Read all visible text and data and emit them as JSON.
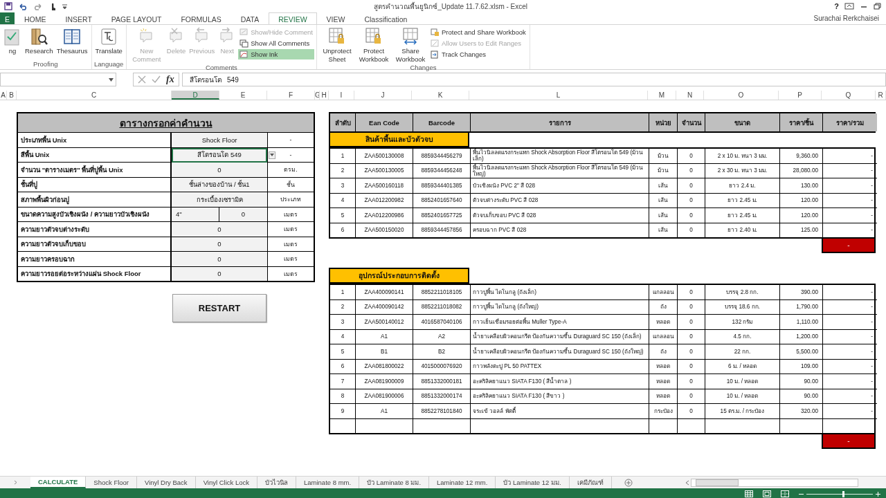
{
  "window": {
    "title": "สูตรคำนวณพื้นยูนิกซ์_Update 11.7.62.xlsm - Excel",
    "help": "?"
  },
  "ribbon_tabs": [
    {
      "label": "E",
      "kind": "file",
      "selected": false
    },
    {
      "label": "HOME",
      "kind": "tab",
      "selected": false
    },
    {
      "label": "INSERT",
      "kind": "tab",
      "selected": false
    },
    {
      "label": "PAGE LAYOUT",
      "kind": "tab",
      "selected": false
    },
    {
      "label": "FORMULAS",
      "kind": "tab",
      "selected": false
    },
    {
      "label": "DATA",
      "kind": "tab",
      "selected": false
    },
    {
      "label": "REVIEW",
      "kind": "tab",
      "selected": true
    },
    {
      "label": "VIEW",
      "kind": "tab",
      "selected": false
    },
    {
      "label": "Classification",
      "kind": "tab",
      "selected": false
    }
  ],
  "user": "Surachai Rerkchaisei",
  "ribbon_groups": [
    {
      "label": "Proofing",
      "commands": [
        {
          "label": "ng",
          "kind": "large",
          "disabled": false,
          "on": false
        },
        {
          "label": "Research",
          "kind": "large",
          "disabled": false,
          "on": false
        },
        {
          "label": "Thesaurus",
          "kind": "large",
          "disabled": false,
          "on": false
        }
      ]
    },
    {
      "label": "Language",
      "commands": [
        {
          "label": "Translate",
          "kind": "large",
          "disabled": false,
          "on": false
        }
      ]
    },
    {
      "label": "Comments",
      "commands": [
        {
          "label": "New Comment",
          "kind": "large",
          "disabled": true,
          "on": false
        },
        {
          "label": "Delete",
          "kind": "large",
          "disabled": true,
          "on": false
        },
        {
          "label": "Previous",
          "kind": "large",
          "disabled": true,
          "on": false
        },
        {
          "label": "Next",
          "kind": "large",
          "disabled": true,
          "on": false
        },
        {
          "label": "Show/Hide Comment",
          "kind": "small",
          "disabled": true,
          "on": false
        },
        {
          "label": "Show All Comments",
          "kind": "small",
          "disabled": false,
          "on": false
        },
        {
          "label": "Show Ink",
          "kind": "small",
          "disabled": false,
          "on": true
        }
      ]
    },
    {
      "label": "Changes",
      "commands": [
        {
          "label": "Unprotect Sheet",
          "kind": "large",
          "disabled": false,
          "on": false
        },
        {
          "label": "Protect Workbook",
          "kind": "large",
          "disabled": false,
          "on": false
        },
        {
          "label": "Share Workbook",
          "kind": "large",
          "disabled": false,
          "on": false
        },
        {
          "label": "Protect and Share Workbook",
          "kind": "small",
          "disabled": false,
          "on": false
        },
        {
          "label": "Allow Users to Edit Ranges",
          "kind": "small",
          "disabled": true,
          "on": false
        },
        {
          "label": "Track Changes",
          "kind": "small",
          "disabled": false,
          "on": false
        }
      ]
    }
  ],
  "formula_bar": {
    "fx": "fx",
    "value": "สีโตรอนโต   549"
  },
  "columns": [
    {
      "label": "A",
      "selected": false
    },
    {
      "label": "B",
      "selected": false
    },
    {
      "label": "C",
      "selected": false
    },
    {
      "label": "D",
      "selected": true
    },
    {
      "label": "E",
      "selected": false
    },
    {
      "label": "F",
      "selected": false
    },
    {
      "label": "G",
      "selected": false
    },
    {
      "label": "H",
      "selected": false
    },
    {
      "label": "I",
      "selected": false
    },
    {
      "label": "J",
      "selected": false
    },
    {
      "label": "K",
      "selected": false
    },
    {
      "label": "L",
      "selected": false
    },
    {
      "label": "M",
      "selected": false
    },
    {
      "label": "N",
      "selected": false
    },
    {
      "label": "O",
      "selected": false
    },
    {
      "label": "P",
      "selected": false
    },
    {
      "label": "Q",
      "selected": false
    },
    {
      "label": "R",
      "selected": false
    }
  ],
  "calc_form": {
    "title": "ตารางกรอกค่าคำนวน",
    "rows": [
      {
        "label": "ประเภทพื้น Unix",
        "values": [
          "Shock Floor"
        ],
        "unit": "-",
        "selected": false
      },
      {
        "label": "สีพื้น Unix",
        "values": [
          "สีโตรอนโต 549"
        ],
        "unit": "-",
        "selected": true
      },
      {
        "label": "จำนวน \"ตารางเมตร\" พื้นที่ปูพื้น Unix",
        "values": [
          "0"
        ],
        "unit": "ตรม.",
        "selected": false
      },
      {
        "label": "ชั้นที่ปู",
        "values": [
          "ชั้นล่างของบ้าน / ชั้น1"
        ],
        "unit": "ชั้น",
        "selected": false
      },
      {
        "label": "สภาพพื้นผิวก่อนปู",
        "values": [
          "กระเบื้องเซรามิค"
        ],
        "unit": "ประเภท",
        "selected": false
      },
      {
        "label": "ขนาดความสูงบัวเชิงผนัง / ความยาวบัวเชิงผนัง",
        "values": [
          "4\"",
          "0"
        ],
        "unit": "เมตร",
        "selected": false
      },
      {
        "label": "ความยาวตัวจบต่างระดับ",
        "values": [
          "0"
        ],
        "unit": "เมตร",
        "selected": false
      },
      {
        "label": "ความยาวตัวจบเก็บขอบ",
        "values": [
          "0"
        ],
        "unit": "เมตร",
        "selected": false
      },
      {
        "label": "ความยาวครอบฉาก",
        "values": [
          "0"
        ],
        "unit": "เมตร",
        "selected": false
      },
      {
        "label": "ความยาวรอยต่อระหว่างแผ่น Shock Floor",
        "values": [
          "0"
        ],
        "unit": "เมตร",
        "selected": false
      }
    ],
    "button": "RESTART"
  },
  "product_table": {
    "columns": [
      "ลำดับ",
      "Ean Code",
      "Barcode",
      "รายการ",
      "หน่วย",
      "จำนวน",
      "ขนาด",
      "ราคา/ชิ้น",
      "ราคา/รวม"
    ],
    "sections": [
      {
        "title": "สินค้าพื้นและบัวตัวจบ",
        "total": "-",
        "rows": [
          {
            "kind": "item",
            "cells": [
              "1",
              "ZAA500130008",
              "8859344456279",
              "พื้นไวนิลลดแรงกระแทก Shock Absorption Floor สีโตรอนโต 549 (ม้วนเล็ก)",
              "ม้วน",
              "0",
              "2 x 10 ม. หนา 3 มม.",
              "9,360.00",
              "-"
            ]
          },
          {
            "kind": "item",
            "cells": [
              "2",
              "ZAA500130005",
              "8859344456248",
              "พื้นไวนิลลดแรงกระแทก Shock Absorption Floor สีโตรอนโต 549 (ม้วนใหญ่)",
              "ม้วน",
              "0",
              "2 x 30 ม. หนา 3 มม.",
              "28,080.00",
              "-"
            ]
          },
          {
            "kind": "item",
            "cells": [
              "3",
              "ZAA500160118",
              "8859344401385",
              "บัวเชิงผนัง PVC 2\" สี 028",
              "เส้น",
              "0",
              "ยาว 2.4 ม.",
              "130.00",
              "-"
            ]
          },
          {
            "kind": "item",
            "cells": [
              "4",
              "ZAA012200982",
              "8852401657640",
              "ตัวจบต่างระดับ PVC สี 028",
              "เส้น",
              "0",
              "ยาว 2.45 ม.",
              "120.00",
              "-"
            ]
          },
          {
            "kind": "item",
            "cells": [
              "5",
              "ZAA012200986",
              "8852401657725",
              "ตัวจบเก็บขอบ PVC สี 028",
              "เส้น",
              "0",
              "ยาว 2.45 ม.",
              "120.00",
              "-"
            ]
          },
          {
            "kind": "item",
            "cells": [
              "6",
              "ZAA500150020",
              "8859344457856",
              "ครอบฉาก PVC สี 028",
              "เส้น",
              "0",
              "ยาว 2.40 ม.",
              "125.00",
              "-"
            ]
          }
        ]
      },
      {
        "title": "อุปกรณ์ประกอบการติดตั้ง",
        "total": "-",
        "rows": [
          {
            "kind": "item",
            "cells": [
              "1",
              "ZAA400090141",
              "8852211018105",
              "กาวปูพื้น ไดโนกลู (ถังเล็ก)",
              "แกลลอน",
              "0",
              "บรรจุ 2.8 กก.",
              "390.00",
              "-"
            ]
          },
          {
            "kind": "item",
            "cells": [
              "2",
              "ZAA400090142",
              "8852211018082",
              "กาวปูพื้น ไดโนกลู  (ถังใหญ่)",
              "ถัง",
              "0",
              "บรรจุ 18.6 กก.",
              "1,790.00",
              "-"
            ]
          },
          {
            "kind": "item",
            "cells": [
              "3",
              "ZAA500140012",
              "4016587040106",
              "กาวเย็นเชื่อมรอยต่อพื้น Muller Type-A",
              "หลอด",
              "0",
              "132 กรัม",
              "1,110.00",
              "-"
            ]
          },
          {
            "kind": "item",
            "cells": [
              "4",
              "A1",
              "A2",
              "น้ำยาเคลือบผิวคอนกรีต ป้องกันความชื้น Duraguard SC 150 (ถังเล็ก)",
              "แกลลอน",
              "0",
              "4.5 กก.",
              "1,200.00",
              "-"
            ]
          },
          {
            "kind": "item",
            "cells": [
              "5",
              "B1",
              "B2",
              "น้ำยาเคลือบผิวคอนกรีต ป้องกันความชื้น Duraguard SC 150 (ถังใหญ่)",
              "ถัง",
              "0",
              "22 กก.",
              "5,500.00",
              "-"
            ]
          },
          {
            "kind": "item",
            "cells": [
              "6",
              "ZAA081800022",
              "4015000076920",
              "กาวพลังตะปู PL 50 PATTEX",
              "หลอด",
              "0",
              "6 ม. / หลอด",
              "109.00",
              "-"
            ]
          },
          {
            "kind": "item",
            "cells": [
              "7",
              "ZAA081900009",
              "8851332000181",
              "อะคริลิคยาแนว SIATA F130 ( สีน้ำตาล )",
              "หลอด",
              "0",
              "10 ม. / หลอด",
              "90.00",
              "-"
            ]
          },
          {
            "kind": "item",
            "cells": [
              "8",
              "ZAA081900006",
              "8851332000174",
              "อะคริลิคยาแนว SIATA F130 ( สีขาว )",
              "หลอด",
              "0",
              "10 ม. / หลอด",
              "90.00",
              "-"
            ]
          },
          {
            "kind": "item",
            "cells": [
              "9",
              "A1",
              "8852278101840",
              "จระเข้ วอลล์ พัตตี้",
              "กระป๋อง",
              "0",
              "15 ตร.ม. / กระป๋อง",
              "320.00",
              "-"
            ]
          },
          {
            "kind": "blank"
          }
        ]
      }
    ]
  },
  "sheet_tabs": [
    {
      "label": "CALCULATE",
      "selected": true
    },
    {
      "label": "Shock Floor",
      "selected": false
    },
    {
      "label": "Vinyl Dry Back",
      "selected": false
    },
    {
      "label": "Vinyl Click Lock",
      "selected": false
    },
    {
      "label": "บัวไวนิล",
      "selected": false
    },
    {
      "label": "Laminate 8 mm.",
      "selected": false
    },
    {
      "label": "บัว Laminate 8 มม.",
      "selected": false
    },
    {
      "label": "Laminate 12 mm.",
      "selected": false
    },
    {
      "label": "บัว Laminate 12 มม.",
      "selected": false
    },
    {
      "label": "เคมีภัณฑ์",
      "selected": false
    }
  ],
  "status_bar": {
    "zoom_slider": {
      "level": 0.55
    }
  }
}
